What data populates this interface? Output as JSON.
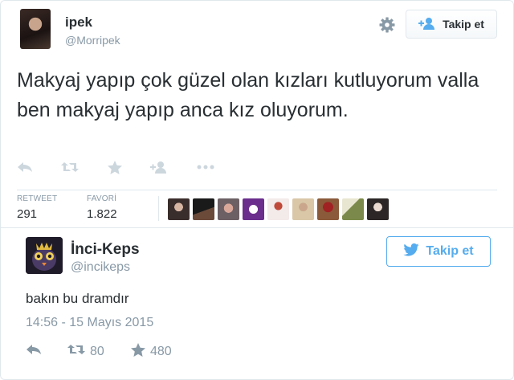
{
  "tweet": {
    "user": {
      "name": "ipek",
      "handle": "@Morripek"
    },
    "follow_label": "Takip et",
    "text": "Makyaj yapıp çok güzel olan kızları kutluyorum valla ben makyaj yapıp anca kız oluyorum.",
    "stats": {
      "retweet_label": "RETWEET",
      "retweet_count": "291",
      "favori_label": "FAVORİ",
      "favori_count": "1.822"
    },
    "favoriters": [
      "avatar",
      "avatar",
      "avatar",
      "avatar",
      "avatar",
      "avatar",
      "avatar",
      "avatar",
      "avatar"
    ]
  },
  "quote": {
    "user": {
      "name": "İnci-Keps",
      "handle": "@incikeps"
    },
    "follow_label": "Takip et",
    "text": "bakın bu dramdır",
    "timestamp": "14:56 - 15 Mayıs 2015",
    "retweet_count": "80",
    "favorite_count": "480"
  },
  "colors": {
    "accent": "#55acee",
    "text": "#292f33",
    "muted": "#8899a6",
    "border": "#e1e8ed"
  },
  "icons": [
    "gear-icon",
    "follow-person-icon",
    "twitter-bird-icon",
    "reply-icon",
    "retweet-icon",
    "star-icon",
    "more-icon"
  ]
}
